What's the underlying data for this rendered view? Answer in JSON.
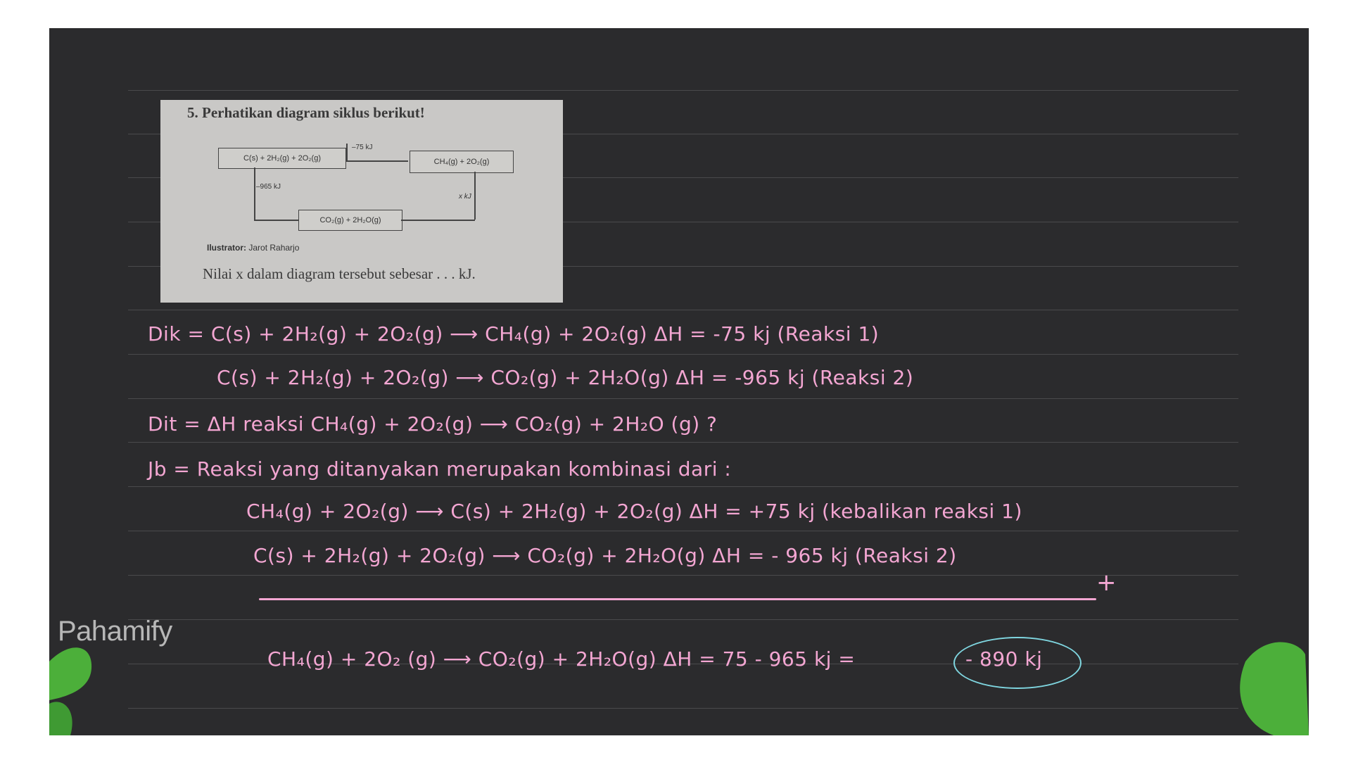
{
  "question": {
    "title": "5. Perhatikan diagram siklus berikut!",
    "box_reactants": "C(s) + 2H₂(g) + 2O₂(g)",
    "box_ch4": "CH₄(g) + 2O₂(g)",
    "box_products": "CO₂(g) + 2H₂O(g)",
    "label_top": "–75 kJ",
    "label_left": "–965 kJ",
    "label_right": "x kJ",
    "illustrator_label": "Ilustrator:",
    "illustrator_name": "Jarot Raharjo",
    "prompt": "Nilai x dalam diagram tersebut sebesar . . . kJ."
  },
  "solution": {
    "dik_line1": "Dik =  C(s) + 2H₂(g) + 2O₂(g) ⟶ CH₄(g) +  2O₂(g)  ΔH = -75 kj    (Reaksi 1)",
    "dik_line2": "C(s) + 2H₂(g) + 2O₂(g) ⟶ CO₂(g) + 2H₂O(g)  ΔH = -965 kj  (Reaksi 2)",
    "dit_line": "Dit =  ΔH reaksi  CH₄(g) + 2O₂(g) ⟶ CO₂(g) + 2H₂O (g) ?",
    "jb_line": "Jb =  Reaksi yang ditanyakan merupakan kombinasi dari :",
    "comb_line1": "CH₄(g) + 2O₂(g) ⟶ C(s) + 2H₂(g) + 2O₂(g)    ΔH = +75 kj  (kebalikan reaksi 1)",
    "comb_line2": "C(s) + 2H₂(g) + 2O₂(g) ⟶ CO₂(g) + 2H₂O(g)  ΔH =  - 965 kj  (Reaksi 2)",
    "plus_sign": "+",
    "result_line": "CH₄(g) + 2O₂ (g)  ⟶  CO₂(g) + 2H₂O(g)  ΔH = 75 - 965 kj =",
    "answer": "- 890 kj"
  },
  "brand": {
    "logo": "Pahamify"
  },
  "colors": {
    "board": "#2b2b2d",
    "ink": "#f3a6d2",
    "circle": "#7fd6e0",
    "leaf": "#4caf3a"
  }
}
